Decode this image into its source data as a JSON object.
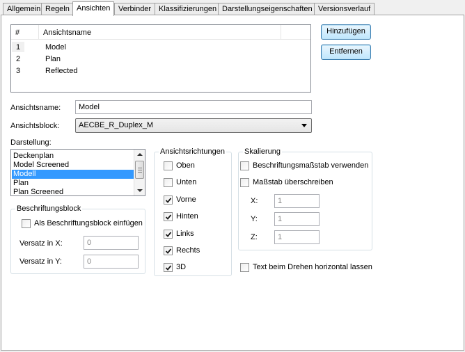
{
  "tabs": [
    "Allgemein",
    "Regeln",
    "Ansichten",
    "Verbinder",
    "Klassifizierungen",
    "Darstellungseigenschaften",
    "Versionsverlauf"
  ],
  "active_tab": "Ansichten",
  "views_table": {
    "columns": [
      "#",
      "Ansichtsname"
    ],
    "rows": [
      {
        "num": "1",
        "name": "Model"
      },
      {
        "num": "2",
        "name": "Plan"
      },
      {
        "num": "3",
        "name": "Reflected"
      }
    ]
  },
  "buttons": {
    "add": "Hinzufügen",
    "remove": "Entfernen"
  },
  "view_name": {
    "label": "Ansichtsname:",
    "value": "Model"
  },
  "view_block": {
    "label": "Ansichtsblock:",
    "value": "AECBE_R_Duplex_M"
  },
  "display": {
    "label": "Darstellung:",
    "items": [
      "Deckenplan",
      "Model Screened",
      "Modell",
      "Plan",
      "Plan Screened"
    ],
    "selected": "Modell"
  },
  "label_block": {
    "title": "Beschriftungsblock",
    "insert_checkbox": "Als Beschriftungsblock einfügen",
    "insert_checked": false,
    "offset_x_label": "Versatz in X:",
    "offset_x_value": "0",
    "offset_y_label": "Versatz in Y:",
    "offset_y_value": "0"
  },
  "directions": {
    "title": "Ansichtsrichtungen",
    "items": [
      {
        "label": "Oben",
        "checked": false
      },
      {
        "label": "Unten",
        "checked": false
      },
      {
        "label": "Vorne",
        "checked": true
      },
      {
        "label": "Hinten",
        "checked": true
      },
      {
        "label": "Links",
        "checked": true
      },
      {
        "label": "Rechts",
        "checked": true
      },
      {
        "label": "3D",
        "checked": true
      }
    ]
  },
  "scaling": {
    "title": "Skalierung",
    "use_annotation_scale": {
      "label": "Beschriftungsmaßstab verwenden",
      "checked": false
    },
    "override_scale": {
      "label": "Maßstab überschreiben",
      "checked": false
    },
    "x_label": "X:",
    "x_value": "1",
    "y_label": "Y:",
    "y_value": "1",
    "z_label": "Z:",
    "z_value": "1"
  },
  "horizontal_text": {
    "label": "Text beim Drehen horizontal lassen",
    "checked": false
  },
  "colors": {
    "selection": "#3399ff",
    "default_button_border": "#3c7fb1"
  }
}
